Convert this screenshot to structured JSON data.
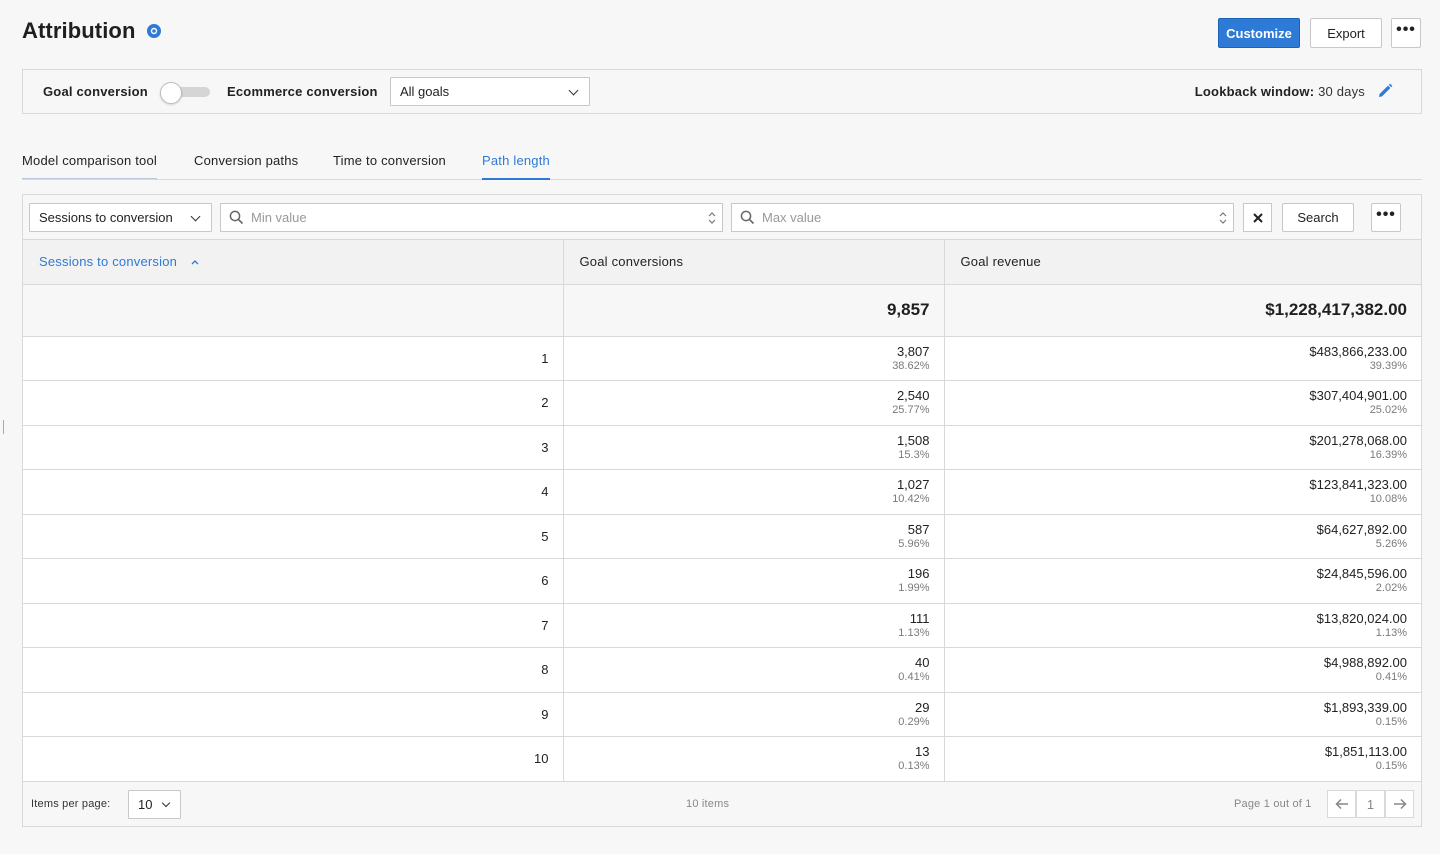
{
  "header": {
    "title": "Attribution",
    "customize_label": "Customize",
    "export_label": "Export",
    "more_label": "•••"
  },
  "settings": {
    "goal_conversion_label": "Goal conversion",
    "goal_conversion_toggle_on": false,
    "ecommerce_conversion_label": "Ecommerce conversion",
    "goals_select_value": "All goals",
    "lookback_label": "Lookback window:",
    "lookback_value": "30 days"
  },
  "tabs": [
    {
      "label": "Model comparison tool",
      "active": false
    },
    {
      "label": "Conversion paths",
      "active": false
    },
    {
      "label": "Time to conversion",
      "active": false
    },
    {
      "label": "Path length",
      "active": true
    }
  ],
  "filters": {
    "dimension_select": "Sessions to conversion",
    "min_placeholder": "Min value",
    "max_placeholder": "Max value",
    "search_label": "Search",
    "more_label": "•••"
  },
  "table": {
    "columns": [
      "Sessions to conversion",
      "Goal conversions",
      "Goal revenue"
    ],
    "sorted_column": "Sessions to conversion",
    "totals": {
      "goal_conversions": "9,857",
      "goal_revenue": "$1,228,417,382.00"
    },
    "rows": [
      {
        "sessions": "1",
        "conversions": "3,807",
        "conversions_pct": "38.62%",
        "revenue": "$483,866,233.00",
        "revenue_pct": "39.39%"
      },
      {
        "sessions": "2",
        "conversions": "2,540",
        "conversions_pct": "25.77%",
        "revenue": "$307,404,901.00",
        "revenue_pct": "25.02%"
      },
      {
        "sessions": "3",
        "conversions": "1,508",
        "conversions_pct": "15.3%",
        "revenue": "$201,278,068.00",
        "revenue_pct": "16.39%"
      },
      {
        "sessions": "4",
        "conversions": "1,027",
        "conversions_pct": "10.42%",
        "revenue": "$123,841,323.00",
        "revenue_pct": "10.08%"
      },
      {
        "sessions": "5",
        "conversions": "587",
        "conversions_pct": "5.96%",
        "revenue": "$64,627,892.00",
        "revenue_pct": "5.26%"
      },
      {
        "sessions": "6",
        "conversions": "196",
        "conversions_pct": "1.99%",
        "revenue": "$24,845,596.00",
        "revenue_pct": "2.02%"
      },
      {
        "sessions": "7",
        "conversions": "111",
        "conversions_pct": "1.13%",
        "revenue": "$13,820,024.00",
        "revenue_pct": "1.13%"
      },
      {
        "sessions": "8",
        "conversions": "40",
        "conversions_pct": "0.41%",
        "revenue": "$4,988,892.00",
        "revenue_pct": "0.41%"
      },
      {
        "sessions": "9",
        "conversions": "29",
        "conversions_pct": "0.29%",
        "revenue": "$1,893,339.00",
        "revenue_pct": "0.15%"
      },
      {
        "sessions": "10",
        "conversions": "13",
        "conversions_pct": "0.13%",
        "revenue": "$1,851,113.00",
        "revenue_pct": "0.15%"
      }
    ]
  },
  "footer": {
    "items_per_page_label": "Items per page:",
    "items_per_page_value": "10",
    "items_count": "10 items",
    "page_info": "Page 1 out of 1",
    "current_page": "1"
  },
  "colors": {
    "accent": "#2d7bd6",
    "border": "#d9d9d9",
    "background": "#f7f7f7"
  }
}
